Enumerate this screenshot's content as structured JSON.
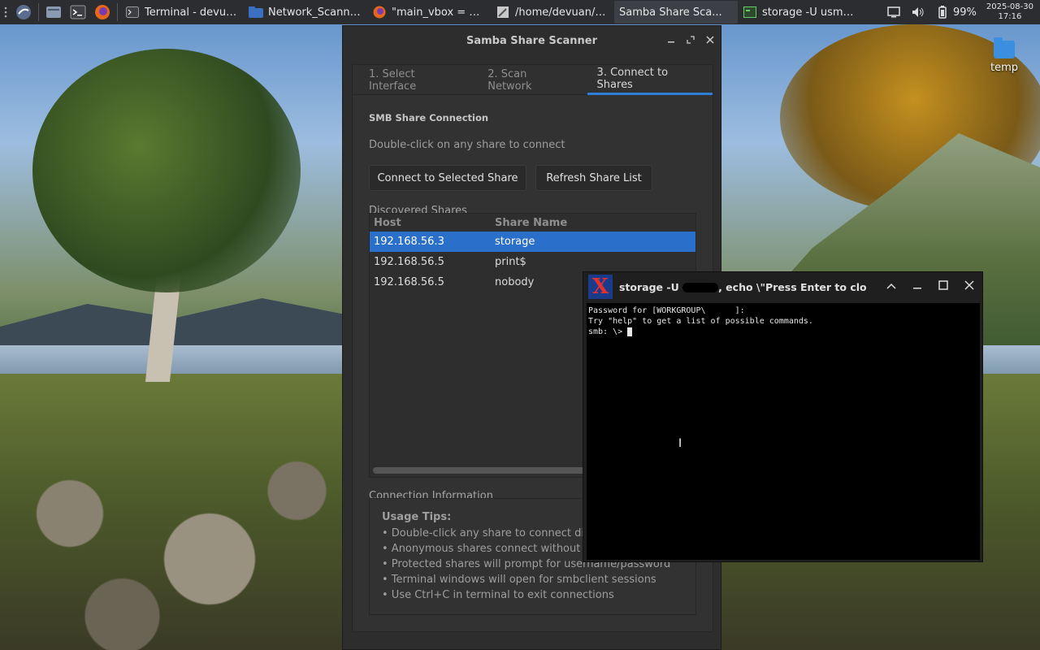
{
  "taskbar": {
    "tasks": [
      {
        "label": "Terminal - devua..."
      },
      {
        "label": "Network_Scanne..."
      },
      {
        "label": "\"main_vbox = Gt..."
      },
      {
        "label": "/home/devuan/S..."
      },
      {
        "label": "Samba Share Sca..."
      },
      {
        "label": "storage -U usma..."
      }
    ],
    "battery": "99%",
    "date": "2025-08-30",
    "time": "17:16"
  },
  "desktop": {
    "icon_label": "temp"
  },
  "main_window": {
    "title": "Samba Share Scanner",
    "tabs": [
      {
        "label": "1. Select Interface"
      },
      {
        "label": "2. Scan Network"
      },
      {
        "label": "3. Connect to Shares"
      }
    ],
    "section_title": "SMB Share Connection",
    "hint": "Double-click on any share to connect",
    "buttons": {
      "connect": "Connect to Selected Share",
      "refresh": "Refresh Share List"
    },
    "shares_group": "Discovered Shares",
    "columns": {
      "host": "Host",
      "share": "Share Name"
    },
    "rows": [
      {
        "host": "192.168.56.3",
        "share": "storage"
      },
      {
        "host": "192.168.56.5",
        "share": "print$"
      },
      {
        "host": "192.168.56.5",
        "share": "nobody"
      }
    ],
    "info_group": "Connection Information",
    "tips_title": "Usage Tips:",
    "tips": [
      "• Double-click any share to connect direct",
      "• Anonymous shares connect without cre",
      "• Protected shares will prompt for username/password",
      "• Terminal windows will open for smbclient sessions",
      "• Use Ctrl+C in terminal to exit connections"
    ]
  },
  "terminal": {
    "title_prefix": "storage -U",
    "title_suffix": ", echo \\\"Press Enter to close...\\\"; re",
    "lines": [
      "Password for [WORKGROUP\\      ]:",
      "Try \"help\" to get a list of possible commands.",
      "smb: \\> "
    ]
  },
  "colors": {
    "accent": "#2d7fd6",
    "selection": "#2a6fc9"
  }
}
